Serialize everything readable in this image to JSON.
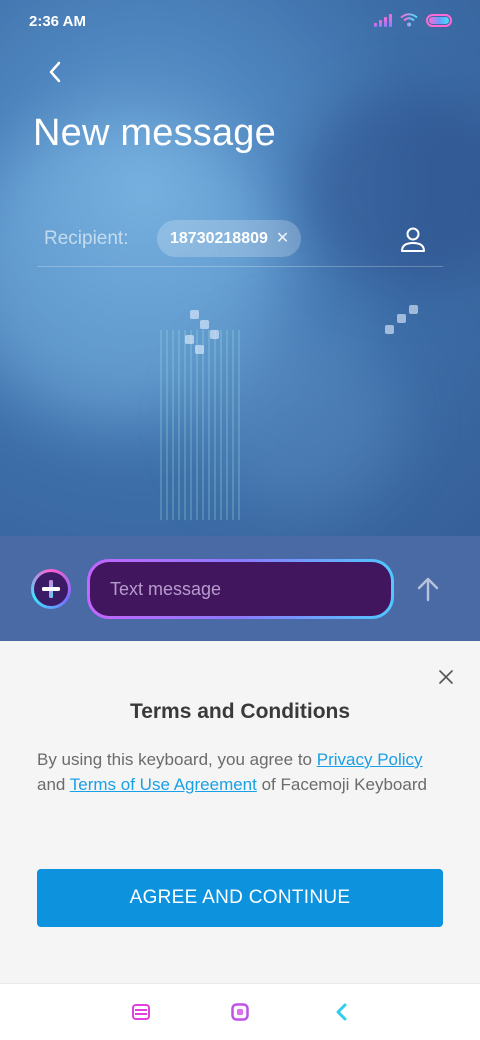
{
  "status_bar": {
    "time": "2:36 AM"
  },
  "header": {
    "title": "New message"
  },
  "recipient": {
    "label": "Recipient:",
    "chip_value": "18730218809",
    "chip_remove": "✕"
  },
  "compose": {
    "placeholder": "Text message"
  },
  "terms": {
    "title": "Terms and Conditions",
    "body_prefix": "By using this keyboard, you agree to ",
    "privacy_link": "Privacy Policy",
    "body_and": " and ",
    "terms_link": "Terms of Use Agreement",
    "body_suffix": " of Facemoji Keyboard",
    "agree_label": "AGREE AND CONTINUE"
  },
  "icons": {
    "back": "back-arrow-icon",
    "contact": "person-icon",
    "add": "plus-icon",
    "send": "up-arrow-icon",
    "close": "close-icon",
    "nav_menu": "menu-icon",
    "nav_home": "home-square-icon",
    "nav_back": "chevron-left-icon"
  },
  "colors": {
    "accent_blue": "#0d92de",
    "link_blue": "#1aa0e6",
    "compose_bar": "#4a6aa6",
    "nav_pink": "#e040e0",
    "nav_cyan": "#33ccf0"
  }
}
